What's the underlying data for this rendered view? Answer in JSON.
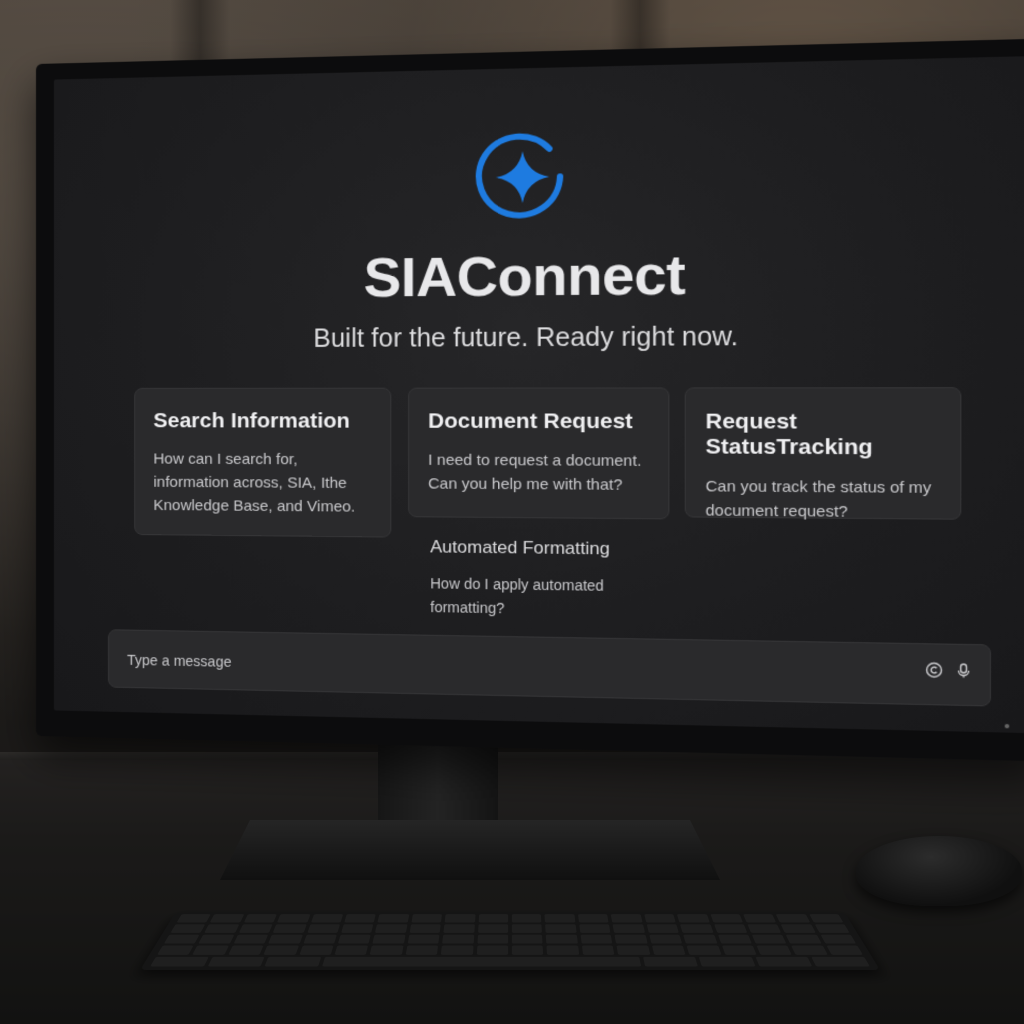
{
  "app": {
    "title": "SIAConnect",
    "tagline": "Built for the future. Ready right now.",
    "logo_icon": "sparkle-ring-icon",
    "accent_color": "#1e7be0"
  },
  "suggestions": [
    {
      "title": "Search Information",
      "body": "How can I search for, information across, SIA, Ithe Knowledge Base, and Vimeo."
    },
    {
      "title": "Document Request",
      "body": "I need to request a document. Can you help me with that?"
    },
    {
      "title": "Request StatusTracking",
      "body": "Can you track the status of my document request?"
    },
    {
      "title": "Automated Formatting",
      "body": "How do I apply automated formatting?"
    }
  ],
  "composer": {
    "placeholder": "Type a message",
    "value": "",
    "icons": [
      "copyright-icon",
      "mic-icon"
    ]
  }
}
